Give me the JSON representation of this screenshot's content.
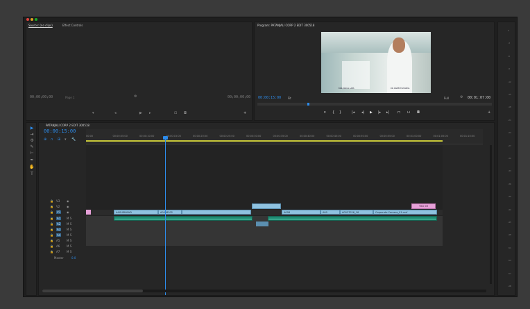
{
  "app": {
    "window_dots": [
      "#e0443e",
      "#dea123",
      "#1aab29"
    ]
  },
  "source_monitor": {
    "tabs": [
      "Source: (no clips)",
      "Effect Controls"
    ],
    "timecode_left": "00;00;00;00",
    "page_label": "Page 1",
    "timecode_right": "00;00;00;00"
  },
  "program_monitor": {
    "tab": "Program: PATANJALI CORP 2 EDIT 300518",
    "timecode_left": "00:00:15:00",
    "fit_label": "Fit",
    "quality": "Full",
    "timecode_right": "00:01:07:00",
    "video_overlay_left": "BIOLOGICAL LABS",
    "video_overlay_right": "DR. RAMESH SHARMA"
  },
  "timeline": {
    "tab": "PATANJALI CORP 2 EDIT 300518",
    "playhead_timecode": "00:00:15:00",
    "ruler": [
      "00:00",
      "00:00:05:00",
      "00:00:10:00",
      "00:00:15:00",
      "00:00:20:00",
      "00:00:25:00",
      "00:00:30:00",
      "00:00:35:00",
      "00:00:40:00",
      "00:00:45:00",
      "00:00:50:00",
      "00:00:55:00",
      "00:01:00:00",
      "00:01:05:00",
      "00:01:10:00"
    ],
    "tracks": [
      "V3",
      "V2",
      "V1",
      "A1",
      "A2",
      "A3",
      "A4",
      "A5",
      "A6",
      "A7"
    ],
    "master_label": "Master",
    "master_value": "0.0",
    "clips": {
      "title": "Title 03",
      "c1": "AASHIRVAAD",
      "c2": "A0036302",
      "c3": "A008",
      "c4": "A00",
      "c5": "A0037026_16",
      "c6": "Corporate Camera_01.mxf"
    }
  },
  "audio_meter": {
    "ticks": [
      "0",
      "-3",
      "-6",
      "-9",
      "-12",
      "-15",
      "-18",
      "-21",
      "-24",
      "-27",
      "-30",
      "-33",
      "-36",
      "-39",
      "-42",
      "-45",
      "-48",
      "-51",
      "-54",
      "-57",
      "-dB"
    ]
  }
}
